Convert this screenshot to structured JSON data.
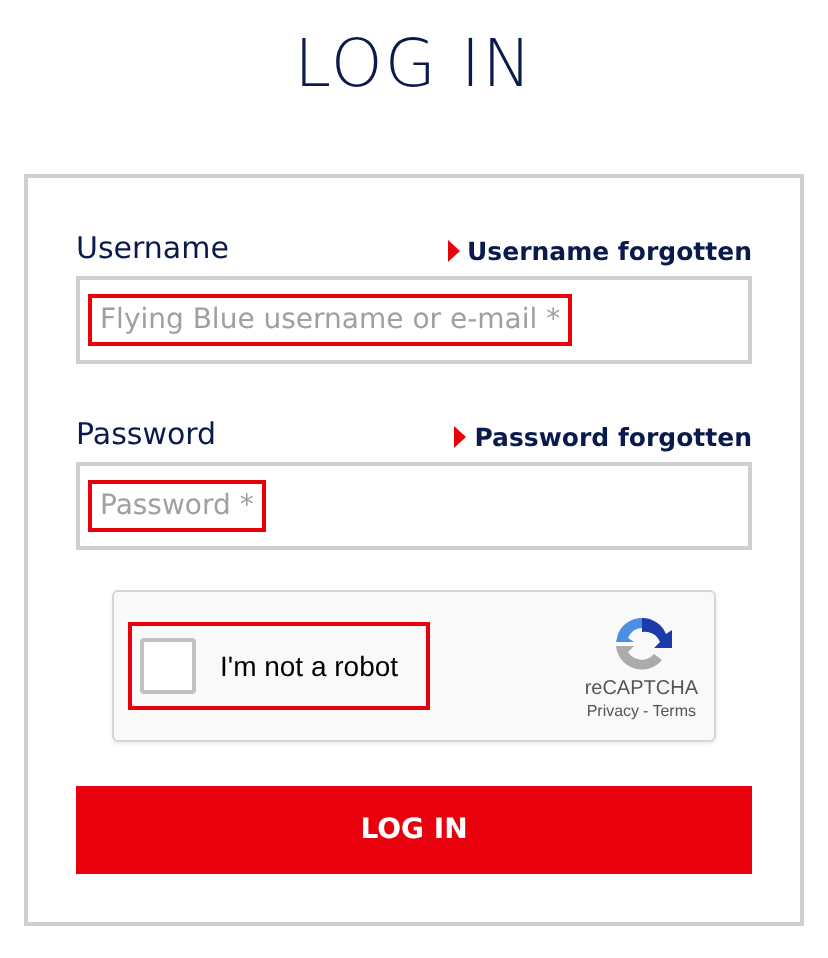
{
  "title": "LOG IN",
  "fields": [
    {
      "label": "Username",
      "link": "Username forgotten",
      "placeholder": "Flying Blue username or e-mail *",
      "highlighted": true
    },
    {
      "label": "Password",
      "link": "Password forgotten",
      "placeholder": "Password *",
      "highlighted": true
    }
  ],
  "captcha": {
    "label": "I'm not a robot",
    "checked": false,
    "highlighted": true,
    "brand": "reCAPTCHA",
    "privacy": "Privacy",
    "separator": "-",
    "terms": "Terms"
  },
  "button": "LOG IN"
}
